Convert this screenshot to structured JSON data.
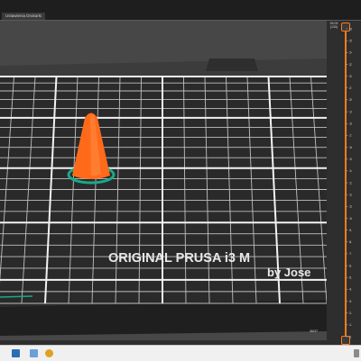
{
  "window": {
    "tab_label": "Ustawienia Drukarki"
  },
  "bed": {
    "brand_text": "ORIGINAL PRUSA i3 M",
    "by_text": "by Jose",
    "bed_color": "#2a2a2a",
    "grid_color": "#e8e8e8",
    "model_color": "#ff6a1a",
    "highlight_color": "#19a98a"
  },
  "vertical_slider": {
    "top_label_1": "26.00",
    "top_label_2": "(130)",
    "tick_labels": [
      "26.00",
      "25.00",
      "24.00",
      "23.00",
      "22.00",
      "21.00",
      "20.00",
      "19.00",
      "18.00",
      "17.00",
      "16.00",
      "15.00",
      "14.00",
      "13.00",
      "12.00",
      "11.00",
      "10.00",
      "9.00",
      "8.00",
      "7.00",
      "6.00",
      "5.00",
      "4.00",
      "3.00",
      "2.00",
      "1.00",
      "0.20"
    ],
    "accent": "#ff7a1a"
  },
  "horizontal_slider": {
    "value_label": "36/37"
  },
  "taskbar": {
    "icons": [
      "windows-explorer-icon",
      "app-icon",
      "chrome-icon",
      "tray-icon"
    ]
  }
}
